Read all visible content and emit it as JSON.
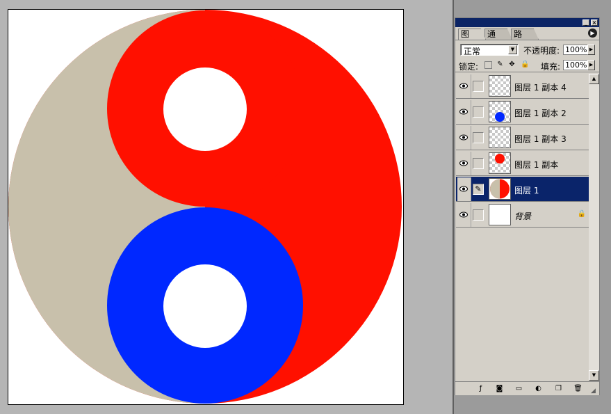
{
  "palette": {
    "tabs": [
      "图层",
      "通道",
      "路径"
    ],
    "active_tab": "图层",
    "blend_mode": "正常",
    "opacity_label": "不透明度:",
    "opacity_value": "100%",
    "lock_label": "锁定:",
    "fill_label": "填充:",
    "fill_value": "100%",
    "layers": [
      {
        "name": "图层 1 副本 4",
        "thumbnail": "empty-transparent",
        "visible": true,
        "selected": false
      },
      {
        "name": "图层 1 副本 2",
        "thumbnail": "blue-dot",
        "visible": true,
        "selected": false
      },
      {
        "name": "图层 1 副本 3",
        "thumbnail": "empty-transparent",
        "visible": true,
        "selected": false
      },
      {
        "name": "图层 1 副本",
        "thumbnail": "red-dot",
        "visible": true,
        "selected": false
      },
      {
        "name": "图层 1",
        "thumbnail": "half-circle",
        "visible": true,
        "selected": true
      },
      {
        "name": "背景",
        "thumbnail": "white",
        "visible": true,
        "selected": false,
        "locked": true
      }
    ]
  },
  "colors": {
    "red": "#ff1000",
    "blue": "#0028ff",
    "beige": "#c8c0ab",
    "selection": "#0a246a",
    "panel_bg": "#d4d0c8",
    "title_bar": "#0b2465"
  },
  "icons": {
    "eye": "eye-icon",
    "brush": "brush-icon",
    "lock": "lock-icon",
    "menu": "palette-menu-icon"
  }
}
